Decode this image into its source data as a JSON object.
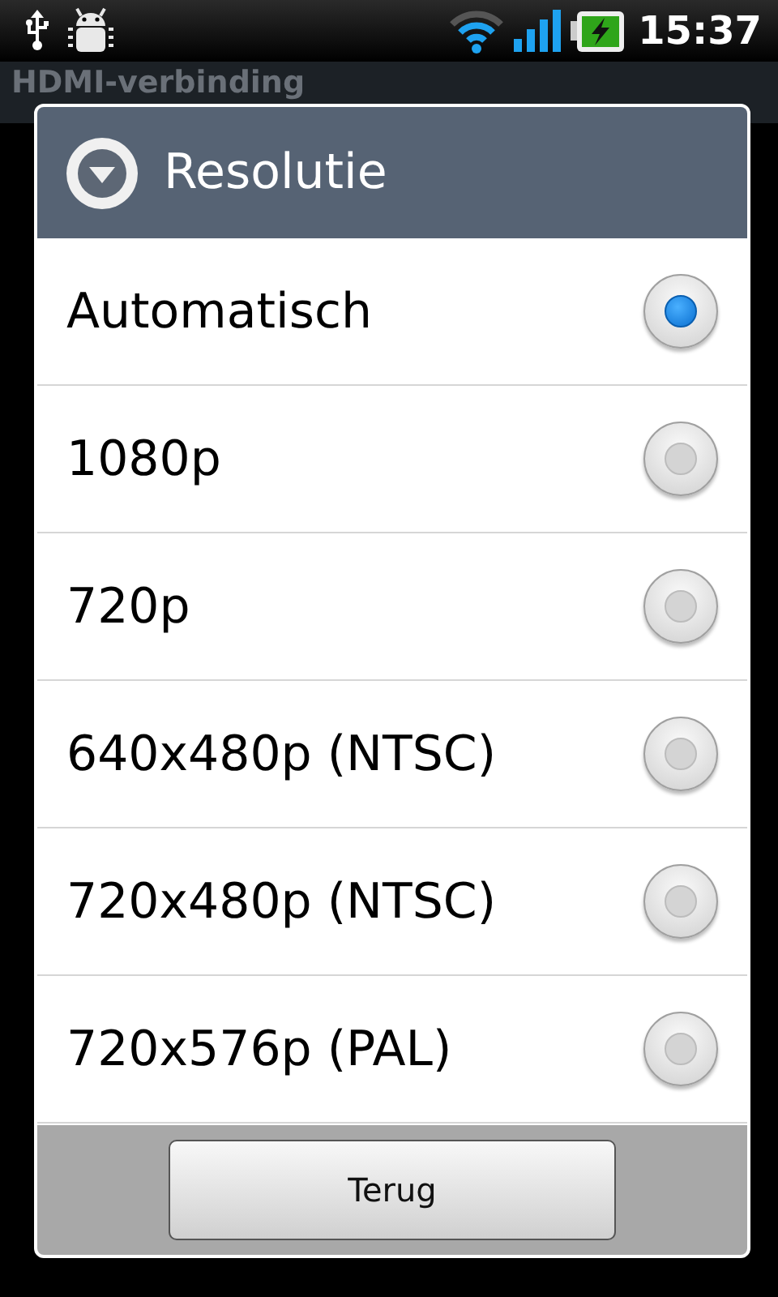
{
  "status_bar": {
    "time": "15:37"
  },
  "app_bar": {
    "title": "HDMI-verbinding"
  },
  "dialog": {
    "title": "Resolutie",
    "options": [
      {
        "label": "Automatisch",
        "selected": true
      },
      {
        "label": "1080p",
        "selected": false
      },
      {
        "label": "720p",
        "selected": false
      },
      {
        "label": "640x480p (NTSC)",
        "selected": false
      },
      {
        "label": "720x480p (NTSC)",
        "selected": false
      },
      {
        "label": "720x576p (PAL)",
        "selected": false
      }
    ],
    "buttons": [
      "Terug"
    ]
  }
}
